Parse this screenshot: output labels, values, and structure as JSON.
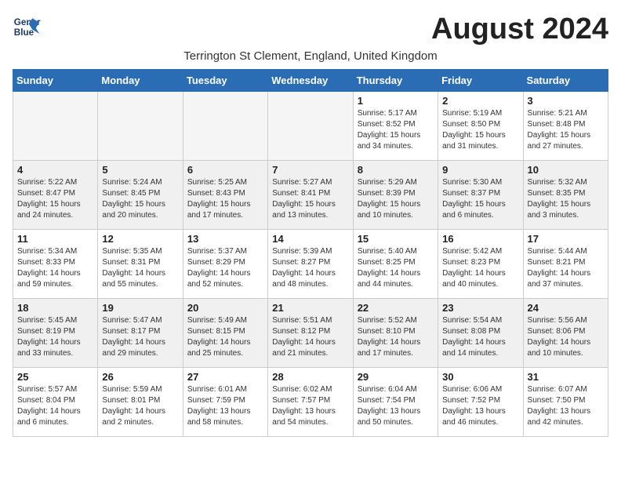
{
  "logo": {
    "line1": "General",
    "line2": "Blue"
  },
  "title": "August 2024",
  "subtitle": "Terrington St Clement, England, United Kingdom",
  "days_of_week": [
    "Sunday",
    "Monday",
    "Tuesday",
    "Wednesday",
    "Thursday",
    "Friday",
    "Saturday"
  ],
  "weeks": [
    [
      {
        "day": "",
        "info": ""
      },
      {
        "day": "",
        "info": ""
      },
      {
        "day": "",
        "info": ""
      },
      {
        "day": "",
        "info": ""
      },
      {
        "day": "1",
        "info": "Sunrise: 5:17 AM\nSunset: 8:52 PM\nDaylight: 15 hours\nand 34 minutes."
      },
      {
        "day": "2",
        "info": "Sunrise: 5:19 AM\nSunset: 8:50 PM\nDaylight: 15 hours\nand 31 minutes."
      },
      {
        "day": "3",
        "info": "Sunrise: 5:21 AM\nSunset: 8:48 PM\nDaylight: 15 hours\nand 27 minutes."
      }
    ],
    [
      {
        "day": "4",
        "info": "Sunrise: 5:22 AM\nSunset: 8:47 PM\nDaylight: 15 hours\nand 24 minutes."
      },
      {
        "day": "5",
        "info": "Sunrise: 5:24 AM\nSunset: 8:45 PM\nDaylight: 15 hours\nand 20 minutes."
      },
      {
        "day": "6",
        "info": "Sunrise: 5:25 AM\nSunset: 8:43 PM\nDaylight: 15 hours\nand 17 minutes."
      },
      {
        "day": "7",
        "info": "Sunrise: 5:27 AM\nSunset: 8:41 PM\nDaylight: 15 hours\nand 13 minutes."
      },
      {
        "day": "8",
        "info": "Sunrise: 5:29 AM\nSunset: 8:39 PM\nDaylight: 15 hours\nand 10 minutes."
      },
      {
        "day": "9",
        "info": "Sunrise: 5:30 AM\nSunset: 8:37 PM\nDaylight: 15 hours\nand 6 minutes."
      },
      {
        "day": "10",
        "info": "Sunrise: 5:32 AM\nSunset: 8:35 PM\nDaylight: 15 hours\nand 3 minutes."
      }
    ],
    [
      {
        "day": "11",
        "info": "Sunrise: 5:34 AM\nSunset: 8:33 PM\nDaylight: 14 hours\nand 59 minutes."
      },
      {
        "day": "12",
        "info": "Sunrise: 5:35 AM\nSunset: 8:31 PM\nDaylight: 14 hours\nand 55 minutes."
      },
      {
        "day": "13",
        "info": "Sunrise: 5:37 AM\nSunset: 8:29 PM\nDaylight: 14 hours\nand 52 minutes."
      },
      {
        "day": "14",
        "info": "Sunrise: 5:39 AM\nSunset: 8:27 PM\nDaylight: 14 hours\nand 48 minutes."
      },
      {
        "day": "15",
        "info": "Sunrise: 5:40 AM\nSunset: 8:25 PM\nDaylight: 14 hours\nand 44 minutes."
      },
      {
        "day": "16",
        "info": "Sunrise: 5:42 AM\nSunset: 8:23 PM\nDaylight: 14 hours\nand 40 minutes."
      },
      {
        "day": "17",
        "info": "Sunrise: 5:44 AM\nSunset: 8:21 PM\nDaylight: 14 hours\nand 37 minutes."
      }
    ],
    [
      {
        "day": "18",
        "info": "Sunrise: 5:45 AM\nSunset: 8:19 PM\nDaylight: 14 hours\nand 33 minutes."
      },
      {
        "day": "19",
        "info": "Sunrise: 5:47 AM\nSunset: 8:17 PM\nDaylight: 14 hours\nand 29 minutes."
      },
      {
        "day": "20",
        "info": "Sunrise: 5:49 AM\nSunset: 8:15 PM\nDaylight: 14 hours\nand 25 minutes."
      },
      {
        "day": "21",
        "info": "Sunrise: 5:51 AM\nSunset: 8:12 PM\nDaylight: 14 hours\nand 21 minutes."
      },
      {
        "day": "22",
        "info": "Sunrise: 5:52 AM\nSunset: 8:10 PM\nDaylight: 14 hours\nand 17 minutes."
      },
      {
        "day": "23",
        "info": "Sunrise: 5:54 AM\nSunset: 8:08 PM\nDaylight: 14 hours\nand 14 minutes."
      },
      {
        "day": "24",
        "info": "Sunrise: 5:56 AM\nSunset: 8:06 PM\nDaylight: 14 hours\nand 10 minutes."
      }
    ],
    [
      {
        "day": "25",
        "info": "Sunrise: 5:57 AM\nSunset: 8:04 PM\nDaylight: 14 hours\nand 6 minutes."
      },
      {
        "day": "26",
        "info": "Sunrise: 5:59 AM\nSunset: 8:01 PM\nDaylight: 14 hours\nand 2 minutes."
      },
      {
        "day": "27",
        "info": "Sunrise: 6:01 AM\nSunset: 7:59 PM\nDaylight: 13 hours\nand 58 minutes."
      },
      {
        "day": "28",
        "info": "Sunrise: 6:02 AM\nSunset: 7:57 PM\nDaylight: 13 hours\nand 54 minutes."
      },
      {
        "day": "29",
        "info": "Sunrise: 6:04 AM\nSunset: 7:54 PM\nDaylight: 13 hours\nand 50 minutes."
      },
      {
        "day": "30",
        "info": "Sunrise: 6:06 AM\nSunset: 7:52 PM\nDaylight: 13 hours\nand 46 minutes."
      },
      {
        "day": "31",
        "info": "Sunrise: 6:07 AM\nSunset: 7:50 PM\nDaylight: 13 hours\nand 42 minutes."
      }
    ]
  ]
}
